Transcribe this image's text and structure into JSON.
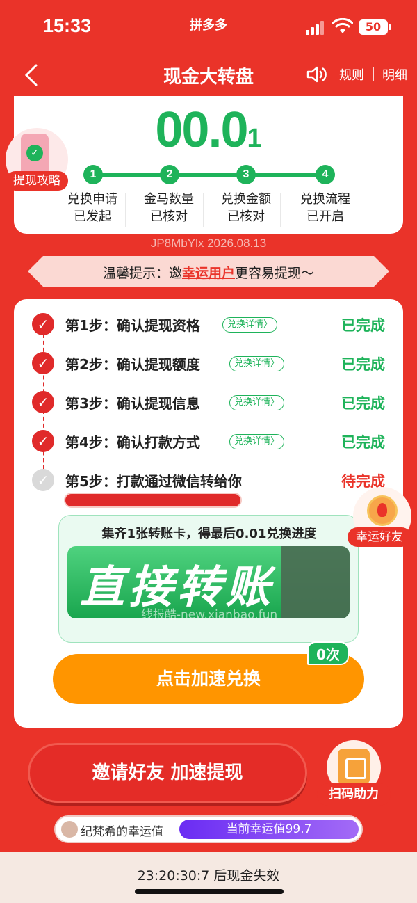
{
  "status_bar": {
    "time": "15:33",
    "app_name": "拼多多",
    "battery": "50"
  },
  "nav": {
    "title": "现金大转盘",
    "rules": "规则",
    "detail": "明细"
  },
  "amount": {
    "main": "00.0",
    "tail": "1",
    "color": "#1eb35a"
  },
  "progress_steps": [
    {
      "num": "1",
      "line1": "兑换申请",
      "line2": "已发起"
    },
    {
      "num": "2",
      "line1": "金马数量",
      "line2": "已核对"
    },
    {
      "num": "3",
      "line1": "兑换金额",
      "line2": "已核对"
    },
    {
      "num": "4",
      "line1": "兑换流程",
      "line2": "已开启"
    }
  ],
  "guide_badge": {
    "label": "提现攻略"
  },
  "code_line": "JP8MbYlx 2026.08.13",
  "tip": {
    "prefix": "温馨提示：邀",
    "highlight": "幸运用户",
    "suffix": "更容易提现～"
  },
  "steps": [
    {
      "title": "第1步：确认提现资格",
      "pill": "兑换详情",
      "status": "已完成"
    },
    {
      "title": "第2步：确认提现额度",
      "pill": "兑换详情",
      "status": "已完成"
    },
    {
      "title": "第3步：确认提现信息",
      "pill": "兑换详情",
      "status": "已完成"
    },
    {
      "title": "第4步：确认打款方式",
      "pill": "兑换详情",
      "status": "已完成"
    },
    {
      "title": "第5步：打款通过微信转给你",
      "pill": "",
      "status": "待完成"
    }
  ],
  "lucky_badge": {
    "label": "幸运好友"
  },
  "transfer": {
    "caption": "集齐1张转账卡，得最后0.01兑换进度",
    "card_text": "直接转账",
    "watermark": "线报酷-new.xianbao.fun"
  },
  "count_tag": "0次",
  "accelerate_button": "点击加速兑换",
  "invite_button": "邀请好友 加速提现",
  "scan_badge": {
    "label": "扫码助力"
  },
  "luck": {
    "label": "纪梵希的幸运值",
    "meter": "当前幸运值99.7"
  },
  "countdown": "23:20:30:7 后现金失效",
  "colors": {
    "brand_red": "#ea3329",
    "success_green": "#1eb35a",
    "accent_orange": "#ff9500",
    "luck_purple": "#6a2cf3"
  }
}
